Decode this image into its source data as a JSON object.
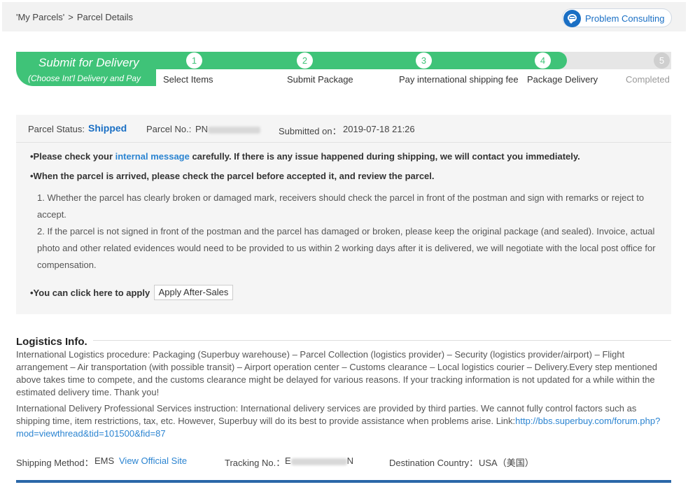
{
  "breadcrumb": {
    "parent": "'My Parcels'",
    "separator": ">",
    "current": "Parcel Details"
  },
  "consult": {
    "label": "Problem Consulting"
  },
  "progress": {
    "head_title": "Submit for Delivery",
    "head_sub": "(Choose Int'l Delivery and Pay",
    "steps": [
      {
        "num": "1",
        "label": "Select Items"
      },
      {
        "num": "2",
        "label": "Submit Package"
      },
      {
        "num": "3",
        "label": "Pay international shipping fee"
      },
      {
        "num": "4",
        "label": "Package Delivery"
      },
      {
        "num": "5",
        "label": "Completed"
      }
    ]
  },
  "status": {
    "status_label": "Parcel Status:",
    "status_value": "Shipped",
    "parcel_label": "Parcel No.:",
    "parcel_prefix": "PN",
    "submitted_label": "Submitted on：",
    "submitted_value": "2019-07-18 21:26"
  },
  "notices": {
    "n1_pre": "•Please check your ",
    "n1_link": "internal message",
    "n1_post": " carefully. If there is any issue happened during shipping, we will contact you immediately.",
    "n2": "•When the parcel is arrived, please check the parcel before accepted it, and review the parcel.",
    "p1": "1. Whether the parcel has clearly broken or damaged mark, receivers should check the parcel in front of the postman and sign with remarks or reject to accept.",
    "p2": "2. If the parcel is not signed in front of the postman and the parcel has damaged or broken, please keep the original package (and sealed). Invoice, actual photo and other related evidences would need to be provided to us within 2 working days after it is delivered, we will negotiate with the local post office for compensation.",
    "apply_label": "•You can click here to apply",
    "apply_button": "Apply After-Sales"
  },
  "logistics": {
    "title": "Logistics Info.",
    "procedure": "International Logistics procedure: Packaging (Superbuy warehouse) – Parcel Collection (logistics provider) – Security (logistics provider/airport) – Flight arrangement – Air transportation (with possible transit) – Airport operation center – Customs clearance – Local logistics courier – Delivery.Every step mentioned above takes time to compete, and the customs clearance might be delayed for various reasons. If your tracking information is not updated for a while within the estimated delivery time. Thank you!",
    "instruction": "International Delivery Professional Services instruction: International delivery services are provided by third parties. We cannot fully control factors such as shipping time, item restrictions, tax, etc. However, Superbuy will do its best to provide assistance when problems arise. Link:",
    "link": "http://bbs.superbuy.com/forum.php?mod=viewthread&tid=101500&fid=87"
  },
  "shipping": {
    "method_label": "Shipping Method：",
    "method_value": "EMS",
    "official_link": "View Official Site",
    "tracking_label": "Tracking No.：",
    "tracking_prefix": "E",
    "tracking_suffix": "N",
    "dest_label": "Destination Country：",
    "dest_value": "USA（美国）"
  }
}
